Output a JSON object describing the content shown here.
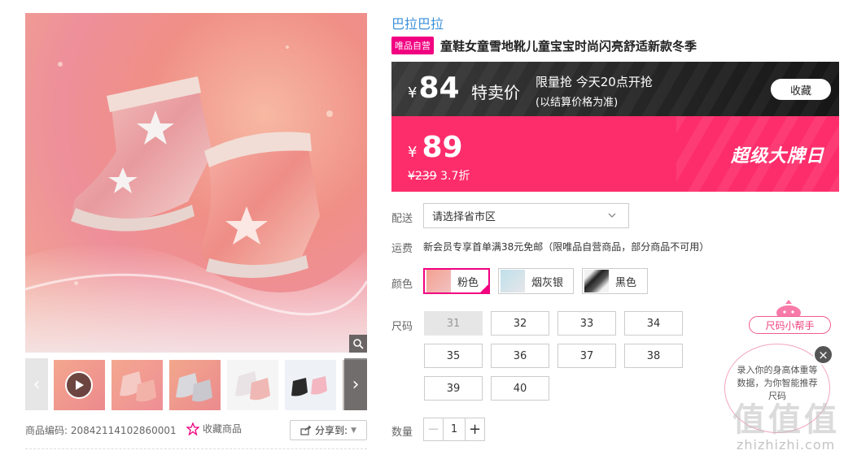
{
  "gallery": {
    "thumbnails": [
      "video-pink-boots",
      "pink-boots-pair",
      "silver-boots-pair",
      "white-boots-sparkle",
      "black-boots",
      "multi-color-boots"
    ],
    "goods_code_label": "商品编码: 20842114102860001",
    "favorite_label": "收藏商品",
    "share_label": "分享到:"
  },
  "product": {
    "brand": "巴拉巴拉",
    "self_operated_tag": "唯品自营",
    "title": "童鞋女童雪地靴儿童宝宝时尚闪亮舒适新款冬季"
  },
  "flash_sale": {
    "currency": "¥",
    "price": "84",
    "label": "特卖价",
    "info_line1": "限量抢 今天20点开抢",
    "info_line2": "(以结算价格为准)",
    "collect_button": "收藏"
  },
  "current_price": {
    "currency": "¥",
    "price": "89",
    "original_price": "¥239",
    "discount": "3.7折",
    "promo_label": "超级大牌日"
  },
  "delivery": {
    "label": "配送",
    "select_value": "请选择省市区"
  },
  "shipping": {
    "label": "运费",
    "text": "新会员专享首单满38元免邮（限唯品自营商品，部分商品不可用）"
  },
  "colors": {
    "label": "颜色",
    "options": [
      {
        "name": "粉色",
        "selected": true
      },
      {
        "name": "烟灰银",
        "selected": false
      },
      {
        "name": "黑色",
        "selected": false
      }
    ]
  },
  "sizes": {
    "label": "尺码",
    "options": [
      "31",
      "32",
      "33",
      "34",
      "35",
      "36",
      "37",
      "38",
      "39",
      "40"
    ],
    "disabled": [
      "31"
    ]
  },
  "quantity": {
    "label": "数量",
    "minus": "−",
    "value": "1",
    "plus": "+"
  },
  "size_helper": {
    "tag": "尺码小帮手",
    "bubble_text": "录入你的身高体重等数据，为你智能推荐尺码",
    "close": "×"
  },
  "watermark": {
    "logo": "值值值",
    "url": "zhizhizhi.com"
  },
  "colors_theme": {
    "accent_pink": "#f10180",
    "price_bar": "#fd2d6b",
    "brand_blue": "#3a8fd9",
    "flash_bar": "#1e1e1e"
  }
}
